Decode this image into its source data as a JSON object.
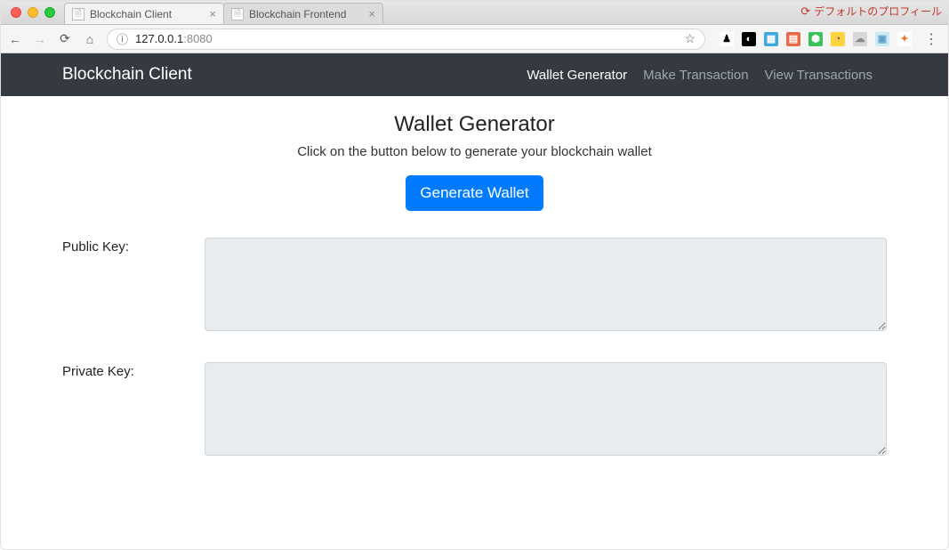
{
  "browser": {
    "tabs": [
      {
        "title": "Blockchain Client",
        "active": true
      },
      {
        "title": "Blockchain Frontend",
        "active": false
      }
    ],
    "profile_label": "デフォルトのプロフィール",
    "url_host": "127.0.0.1",
    "url_port": ":8080",
    "extensions": [
      {
        "name": "ext-1",
        "bg": "#ffffff",
        "fg": "#000000",
        "glyph": "♟"
      },
      {
        "name": "ext-mask",
        "bg": "#000000",
        "fg": "#ffffff",
        "glyph": "◐"
      },
      {
        "name": "ext-translate",
        "bg": "#3da9de",
        "fg": "#ffffff",
        "glyph": "▦"
      },
      {
        "name": "ext-grid",
        "bg": "#e86b4a",
        "fg": "#ffffff",
        "glyph": "▤"
      },
      {
        "name": "ext-bug",
        "bg": "#3bc15a",
        "fg": "#ffffff",
        "glyph": "⬢"
      },
      {
        "name": "ext-clock",
        "bg": "#ffd23f",
        "fg": "#555555",
        "glyph": "◔"
      },
      {
        "name": "ext-cloud",
        "bg": "#d7d7d7",
        "fg": "#888888",
        "glyph": "☁"
      },
      {
        "name": "ext-doc",
        "bg": "#cfeaf7",
        "fg": "#5aa0c8",
        "glyph": "▣"
      },
      {
        "name": "ext-fox",
        "bg": "#ffffff",
        "fg": "#e8762d",
        "glyph": "✦"
      }
    ]
  },
  "navbar": {
    "brand": "Blockchain Client",
    "links": [
      {
        "label": "Wallet Generator",
        "active": true
      },
      {
        "label": "Make Transaction",
        "active": false
      },
      {
        "label": "View Transactions",
        "active": false
      }
    ]
  },
  "page": {
    "title": "Wallet Generator",
    "subtitle": "Click on the button below to generate your blockchain wallet",
    "generate_label": "Generate Wallet",
    "public_key_label": "Public Key:",
    "private_key_label": "Private Key:",
    "public_key_value": "",
    "private_key_value": ""
  }
}
